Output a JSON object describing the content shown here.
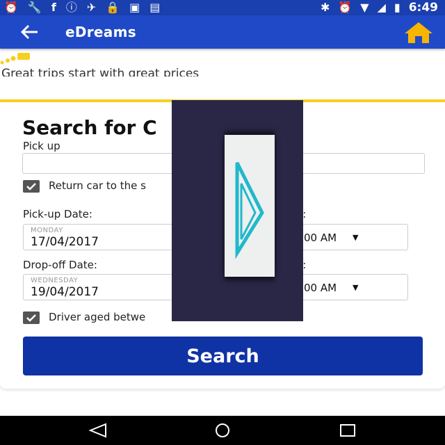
{
  "status_bar": {
    "time": "6:49",
    "left_icons": [
      "alarm-icon",
      "wrench-icon",
      "facebook-icon",
      "info-icon",
      "news-icon",
      "lock-icon",
      "android-icon",
      "image-icon"
    ],
    "right_icons": [
      "bluetooth-icon",
      "alarm-icon",
      "wifi-icon",
      "signal-icon",
      "battery-icon"
    ]
  },
  "app_bar": {
    "title": "eDreams",
    "back_icon": "arrow-left-icon",
    "home_icon": "home-icon",
    "home_color": "#f7b500"
  },
  "tagline": "Great trips start with great prices",
  "form": {
    "heading": "Search for C",
    "pickup_label": "Pick up",
    "pickup_value": "",
    "return_same_label": "Return car to the s",
    "return_same_checked": true,
    "pickup_date_label": "Pick-up Date:",
    "pickup_day": "MONDAY",
    "pickup_date": "17/04/2017",
    "pickup_time_label": "e:",
    "pickup_time": "00 AM",
    "dropoff_date_label": "Drop-off Date:",
    "dropoff_day": "WEDNESDAY",
    "dropoff_date": "19/04/2017",
    "dropoff_time_label": "e:",
    "dropoff_time": "00 AM",
    "driver_age_label": "Driver aged betwe",
    "driver_age_checked": true,
    "search_button": "Search"
  },
  "colors": {
    "status_bar": "#1a3fae",
    "app_bar": "#2049c8",
    "accent_yellow": "#f7cf1f",
    "search_button": "#0f32a4",
    "overlay": "#2a2746",
    "overlay_icon_accent": "#22b8cc"
  },
  "nav_bar": {
    "icons": [
      "nav-back-icon",
      "nav-home-icon",
      "nav-recents-icon"
    ]
  }
}
